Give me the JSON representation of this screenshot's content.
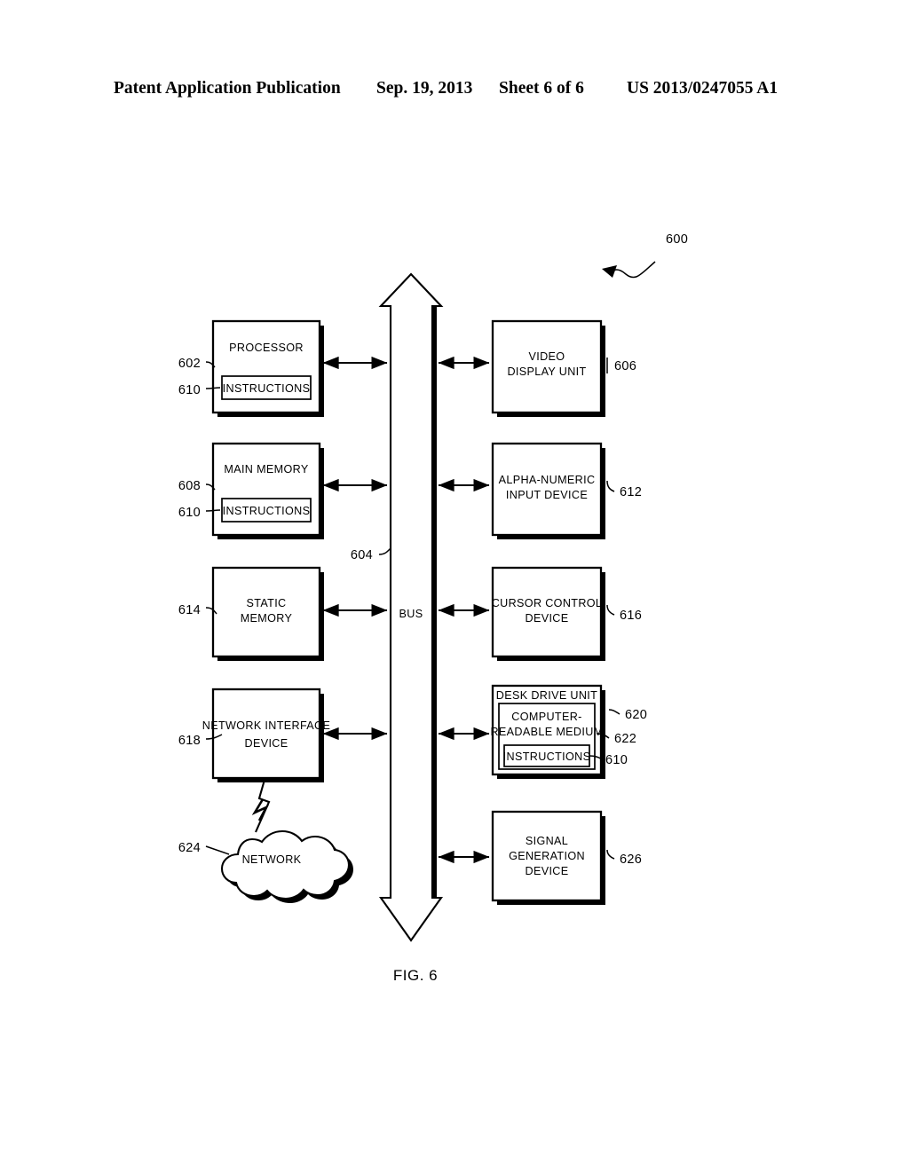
{
  "header": {
    "publication": "Patent Application Publication",
    "date": "Sep. 19, 2013",
    "sheet": "Sheet 6 of 6",
    "patent_number": "US 2013/0247055 A1"
  },
  "figure": {
    "caption": "FIG. 6",
    "system_ref": "600",
    "bus_label": "BUS",
    "bus_ref": "604"
  },
  "blocks": {
    "processor": {
      "label": "PROCESSOR",
      "ref": "602"
    },
    "processor_instr": {
      "label": "INSTRUCTIONS",
      "ref": "610"
    },
    "main_memory": {
      "label": "MAIN MEMORY",
      "ref": "608"
    },
    "main_memory_instr": {
      "label": "INSTRUCTIONS",
      "ref": "610"
    },
    "static_memory": {
      "line1": "STATIC",
      "line2": "MEMORY",
      "ref": "614"
    },
    "network_interface": {
      "line1": "NETWORK INTERFACE",
      "line2": "DEVICE",
      "ref": "618"
    },
    "network_cloud": {
      "label": "NETWORK",
      "ref": "624"
    },
    "video_display": {
      "line1": "VIDEO",
      "line2": "DISPLAY UNIT",
      "ref": "606"
    },
    "alpha_numeric": {
      "line1": "ALPHA-NUMERIC",
      "line2": "INPUT DEVICE",
      "ref": "612"
    },
    "cursor_control": {
      "line1": "CURSOR CONTROL",
      "line2": "DEVICE",
      "ref": "616"
    },
    "disk_drive": {
      "label": "DESK DRIVE UNIT",
      "ref": "620"
    },
    "computer_medium": {
      "line1": "COMPUTER-",
      "line2": "READABLE MEDIUM",
      "ref": "622"
    },
    "disk_instr": {
      "label": "INSTRUCTIONS",
      "ref": "610"
    },
    "signal_generation": {
      "line1": "SIGNAL",
      "line2": "GENERATION",
      "line3": "DEVICE",
      "ref": "626"
    }
  },
  "colors": {
    "ink": "#000000",
    "paper": "#ffffff"
  }
}
